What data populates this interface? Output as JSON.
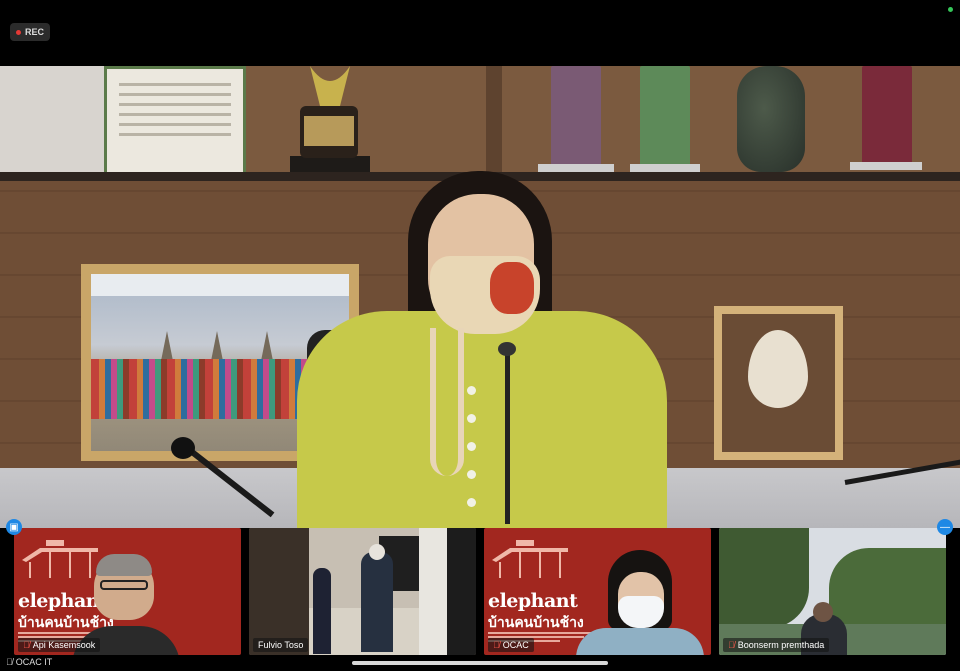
{
  "toolbar": {
    "rec_label": "REC"
  },
  "active_speaker": {
    "description_icon": "video-feed"
  },
  "participants": [
    {
      "name": "Api Kasemsook",
      "muted": true,
      "background": "elephant",
      "elephant_word": "elephant",
      "elephant_thai": "บ้านคนบ้านช้าง"
    },
    {
      "name": "Fulvio Toso",
      "muted": false,
      "background": "gallery"
    },
    {
      "name": "OCAC",
      "muted": true,
      "background": "elephant",
      "elephant_word": "elephant",
      "elephant_thai": "บ้านคนบ้านช้าง"
    },
    {
      "name": "Boonserm premthada",
      "muted": true,
      "background": "outdoor"
    }
  ],
  "self_view": {
    "name": "OCAC IT",
    "muted": true
  },
  "colors": {
    "accent": "#1e88e5",
    "rec_dot": "#e53935",
    "muted": "#ff5a4d",
    "elephant_bg": "#a2271f"
  }
}
